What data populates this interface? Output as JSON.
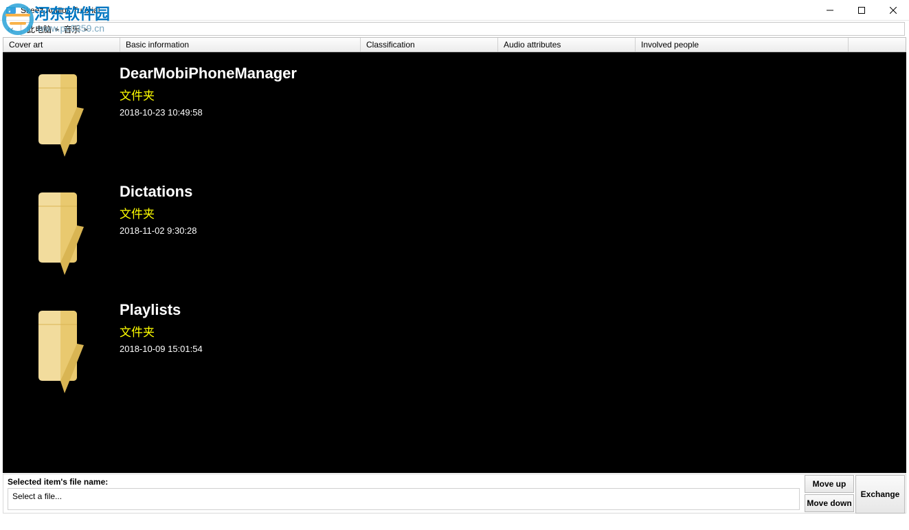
{
  "window": {
    "title": "Skeez Audios Tutorial"
  },
  "breadcrumb": {
    "seg1": "此电脑",
    "seg2": "音乐"
  },
  "columns": {
    "cover": "Cover art",
    "basic": "Basic information",
    "classification": "Classification",
    "audio": "Audio attributes",
    "people": "Involved people"
  },
  "items": [
    {
      "title": "DearMobiPhoneManager",
      "type": "文件夹",
      "date": "2018-10-23 10:49:58"
    },
    {
      "title": "Dictations",
      "type": "文件夹",
      "date": "2018-11-02 9:30:28"
    },
    {
      "title": "Playlists",
      "type": "文件夹",
      "date": "2018-10-09 15:01:54"
    }
  ],
  "footer": {
    "label": "Selected item's file name:",
    "value": "Select a file...",
    "move_up": "Move up",
    "move_down": "Move down",
    "exchange": "Exchange"
  },
  "watermark": {
    "line1": "河东软件园",
    "line2": "www.pc0359.cn"
  }
}
